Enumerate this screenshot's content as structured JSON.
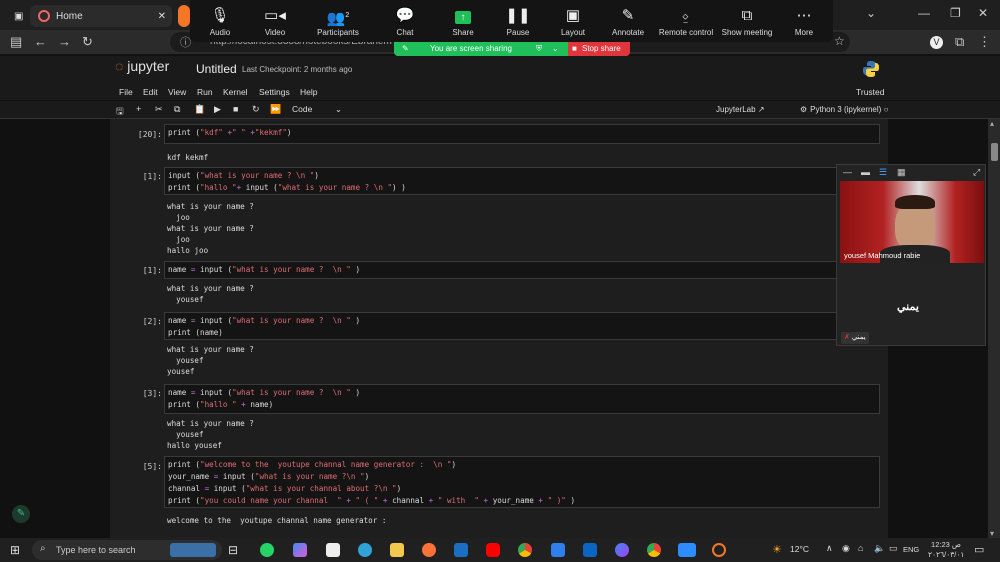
{
  "browser": {
    "tab_home_label": "Home",
    "url": "http://localhost:8888/notebooks/Ebrahem Ad"
  },
  "zoom_toolbar": {
    "participants_count": "2",
    "items": [
      {
        "label": "Audio",
        "icon": "mic-icon"
      },
      {
        "label": "Video",
        "icon": "video-icon"
      },
      {
        "label": "Participants",
        "icon": "participants-icon"
      },
      {
        "label": "Chat",
        "icon": "chat-icon"
      },
      {
        "label": "Share",
        "icon": "share-icon"
      },
      {
        "label": "Pause",
        "icon": "pause-icon"
      },
      {
        "label": "Layout",
        "icon": "layout-icon"
      },
      {
        "label": "Annotate",
        "icon": "annotate-icon"
      },
      {
        "label": "Remote control",
        "icon": "remote-control-icon"
      },
      {
        "label": "Show meeting",
        "icon": "show-meeting-icon"
      },
      {
        "label": "More",
        "icon": "more-icon"
      }
    ],
    "sharing_banner": "You are screen sharing",
    "stop_share": "Stop share",
    "accent_green": "#1fbf5a",
    "stop_red": "#e0353b"
  },
  "jupyter": {
    "logo_text": "jupyter",
    "notebook_title": "Untitled",
    "checkpoint": "Last Checkpoint: 2 months ago",
    "menu": [
      "File",
      "Edit",
      "View",
      "Run",
      "Kernel",
      "Settings",
      "Help"
    ],
    "trusted": "Trusted",
    "cell_type": "Code",
    "jupyterlab_link": "JupyterLab",
    "kernel": "Python 3 (ipykernel)",
    "brand_orange": "#f37726"
  },
  "cells": [
    {
      "prompt": "[20]:",
      "output": "kdf kekmf"
    },
    {
      "prompt": "[1]:",
      "output": "what is your name ?\n  joo\nwhat is your name ?\n  joo\nhallo joo"
    },
    {
      "prompt": "[1]:",
      "output": "what is your name ?\n  yousef"
    },
    {
      "prompt": "[2]:",
      "output": "what is your name ?\n  yousef\nyousef"
    },
    {
      "prompt": "[3]:",
      "output": "what is your name ?\n  yousef\nhallo yousef"
    },
    {
      "prompt": "[5]:",
      "output": "welcome to the  youtupe channal name generator :"
    }
  ],
  "video_panel": {
    "participant_name": "yousef Mahmoud rabie",
    "self_name": "يمني",
    "self_tag": "يمني"
  },
  "taskbar": {
    "search_placeholder": "Type here to search",
    "temperature": "12°C",
    "language": "ENG",
    "time": "12:23 ص",
    "date": "٢٠٢٦/٠٣/٠١"
  }
}
